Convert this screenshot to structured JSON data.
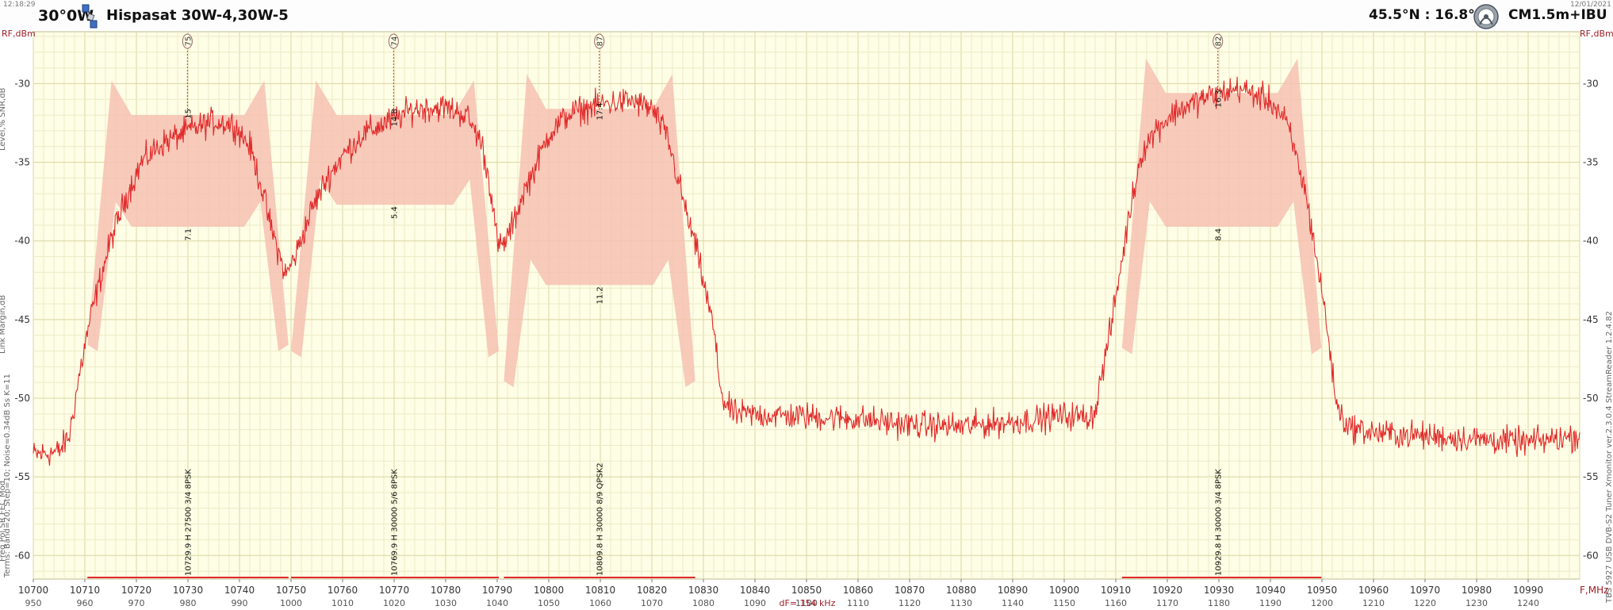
{
  "header": {
    "time_left": "12:18:29",
    "date_right": "12/01/2021",
    "position": "30°0W",
    "satellite_name": "Hispasat 30W-4,30W-5",
    "location": "45.5°N : 16.8°E",
    "antenna": "CM1.5m+IBU",
    "satellite_icon": "satellite-icon",
    "dish_icon": "dish-globe-icon"
  },
  "side_labels": {
    "left_rail_top": "Level,%   SNR,dB",
    "left_rail_mid": "Link Margin,dB",
    "left_rail_bottom": "Terms: Band=20; Step=10; Noise=0.34dB   Ss  K=11",
    "left_rail_fields": "Freq   Pol   SR   FEC   Mod",
    "right_rail": "TBS 5927 USB DVB-S2 Tuner   Xmonitor ver.2.3.0.4   StreamReader 1.2.4.82"
  },
  "colors": {
    "plot_bg": "#fefde5",
    "grid_minor": "#ecebc8",
    "grid_major": "#d9d6a2",
    "trace": "#e12a2a",
    "fill": "#f6c1b3",
    "axis_text": "#333333",
    "unit_text": "#a0202a"
  },
  "chart_data": {
    "type": "line",
    "title": "Hispasat 30W-4,30W-5",
    "xlabel": "F,MHz",
    "ylabel": "RF,dBm",
    "xlim": [
      10700,
      11000
    ],
    "ylim": [
      -61.5,
      -26.7
    ],
    "x_ticks": [
      10700,
      10710,
      10720,
      10730,
      10740,
      10750,
      10760,
      10770,
      10780,
      10790,
      10800,
      10810,
      10820,
      10830,
      10840,
      10850,
      10860,
      10870,
      10880,
      10890,
      10900,
      10910,
      10920,
      10930,
      10940,
      10950,
      10960,
      10970,
      10980,
      10990
    ],
    "if_ticks": [
      950,
      960,
      970,
      980,
      990,
      1000,
      1010,
      1020,
      1030,
      1040,
      1050,
      1060,
      1070,
      1080,
      1090,
      1100,
      1110,
      1120,
      1130,
      1140,
      1150,
      1160,
      1170,
      1180,
      1190,
      1200,
      1210,
      1220,
      1230,
      1240
    ],
    "y_ticks": [
      -30,
      -35,
      -40,
      -45,
      -50,
      -55,
      -60
    ],
    "y_tick_labels": [
      "-30",
      "-35",
      "-40",
      "-45",
      "-50",
      "-55",
      "-60"
    ],
    "right_unit": "RF,dBm",
    "df_label": "dF= 154 kHz",
    "grid": true,
    "legend": "none",
    "trace_shape": [
      [
        10700,
        -53.6
      ],
      [
        10705,
        -53.4
      ],
      [
        10707,
        -52.4
      ],
      [
        10709,
        -48.4
      ],
      [
        10711,
        -45.0
      ],
      [
        10713,
        -42.4
      ],
      [
        10715,
        -40.0
      ],
      [
        10718,
        -37.2
      ],
      [
        10721,
        -35.0
      ],
      [
        10725,
        -33.8
      ],
      [
        10730,
        -33.0
      ],
      [
        10735,
        -32.4
      ],
      [
        10739,
        -32.6
      ],
      [
        10742,
        -34.0
      ],
      [
        10744,
        -36.2
      ],
      [
        10746,
        -39.0
      ],
      [
        10748,
        -41.2
      ],
      [
        10749,
        -42.2
      ],
      [
        10751,
        -40.8
      ],
      [
        10754,
        -38.0
      ],
      [
        10757,
        -36.0
      ],
      [
        10760,
        -34.6
      ],
      [
        10764,
        -33.2
      ],
      [
        10769,
        -32.4
      ],
      [
        10774,
        -31.6
      ],
      [
        10780,
        -31.5
      ],
      [
        10784,
        -32.0
      ],
      [
        10787,
        -33.8
      ],
      [
        10789,
        -37.2
      ],
      [
        10790,
        -40.2
      ],
      [
        10791,
        -40.4
      ],
      [
        10793,
        -39.0
      ],
      [
        10795,
        -37.0
      ],
      [
        10797,
        -35.6
      ],
      [
        10800,
        -33.2
      ],
      [
        10804,
        -31.9
      ],
      [
        10810,
        -31.3
      ],
      [
        10816,
        -31.1
      ],
      [
        10820,
        -31.6
      ],
      [
        10823,
        -33.4
      ],
      [
        10825,
        -36.0
      ],
      [
        10827,
        -38.6
      ],
      [
        10829,
        -41.0
      ],
      [
        10830,
        -42.6
      ],
      [
        10832,
        -45.6
      ],
      [
        10833,
        -48.6
      ],
      [
        10834,
        -50.3
      ],
      [
        10836,
        -51.0
      ],
      [
        10845,
        -51.1
      ],
      [
        10860,
        -51.3
      ],
      [
        10870,
        -51.7
      ],
      [
        10880,
        -51.8
      ],
      [
        10890,
        -51.5
      ],
      [
        10900,
        -51.1
      ],
      [
        10905,
        -51.2
      ],
      [
        10906,
        -50.8
      ],
      [
        10907,
        -49.0
      ],
      [
        10909,
        -45.6
      ],
      [
        10911,
        -41.6
      ],
      [
        10913,
        -37.6
      ],
      [
        10915,
        -34.4
      ],
      [
        10918,
        -32.8
      ],
      [
        10922,
        -31.7
      ],
      [
        10928,
        -30.8
      ],
      [
        10934,
        -30.3
      ],
      [
        10940,
        -31.1
      ],
      [
        10943,
        -32.4
      ],
      [
        10945,
        -34.6
      ],
      [
        10947,
        -37.2
      ],
      [
        10949,
        -41.2
      ],
      [
        10951,
        -45.4
      ],
      [
        10952,
        -48.4
      ],
      [
        10953,
        -50.6
      ],
      [
        10955,
        -51.8
      ],
      [
        10960,
        -52.2
      ],
      [
        10970,
        -52.4
      ],
      [
        10980,
        -52.6
      ],
      [
        10990,
        -52.8
      ],
      [
        11000,
        -52.4
      ]
    ],
    "trace_noise_db": 0.55,
    "transponders": [
      {
        "freq": 10729.9,
        "pol": "H",
        "sr": 27500,
        "fec": "3/4",
        "mod": "8PSK",
        "label": "10729.9  H  27500 3/4  8PSK",
        "level": "75",
        "snr": "15",
        "margin": "7.1",
        "band": [
          10710.5,
          10749.5
        ],
        "env_top": -32.0,
        "env_mid": -39.1,
        "env_edge": -46.6,
        "snr_y": -31.5,
        "margin_y": -39.2
      },
      {
        "freq": 10769.9,
        "pol": "H",
        "sr": 30000,
        "fec": "5/6",
        "mod": "8PSK",
        "label": "10769.9  H  30000 5/6  8PSK",
        "level": "74",
        "snr": "14.8",
        "margin": "5.4",
        "band": [
          10750.0,
          10790.3
        ],
        "env_top": -32.0,
        "env_mid": -37.7,
        "env_edge": -47.0,
        "snr_y": -31.5,
        "margin_y": -37.8
      },
      {
        "freq": 10809.8,
        "pol": "H",
        "sr": 30000,
        "fec": "8/9",
        "mod": "QPSK2",
        "label": "10809.8  H  30000 8/9  QPSK2",
        "level": "87",
        "snr": "17.4",
        "margin": "11.2",
        "band": [
          10791.3,
          10828.4
        ],
        "env_top": -31.6,
        "env_mid": -42.8,
        "env_edge": -48.9,
        "snr_y": -31.1,
        "margin_y": -42.9
      },
      {
        "freq": 10929.8,
        "pol": "H",
        "sr": 30000,
        "fec": "3/4",
        "mod": "8PSK",
        "label": "10929.8  H  30000 3/4  8PSK",
        "level": "82",
        "snr": "16.3",
        "margin": "8.4",
        "band": [
          10911.2,
          10949.9
        ],
        "env_top": -30.6,
        "env_mid": -39.1,
        "env_edge": -46.8,
        "snr_y": -30.3,
        "margin_y": -39.2
      }
    ]
  }
}
